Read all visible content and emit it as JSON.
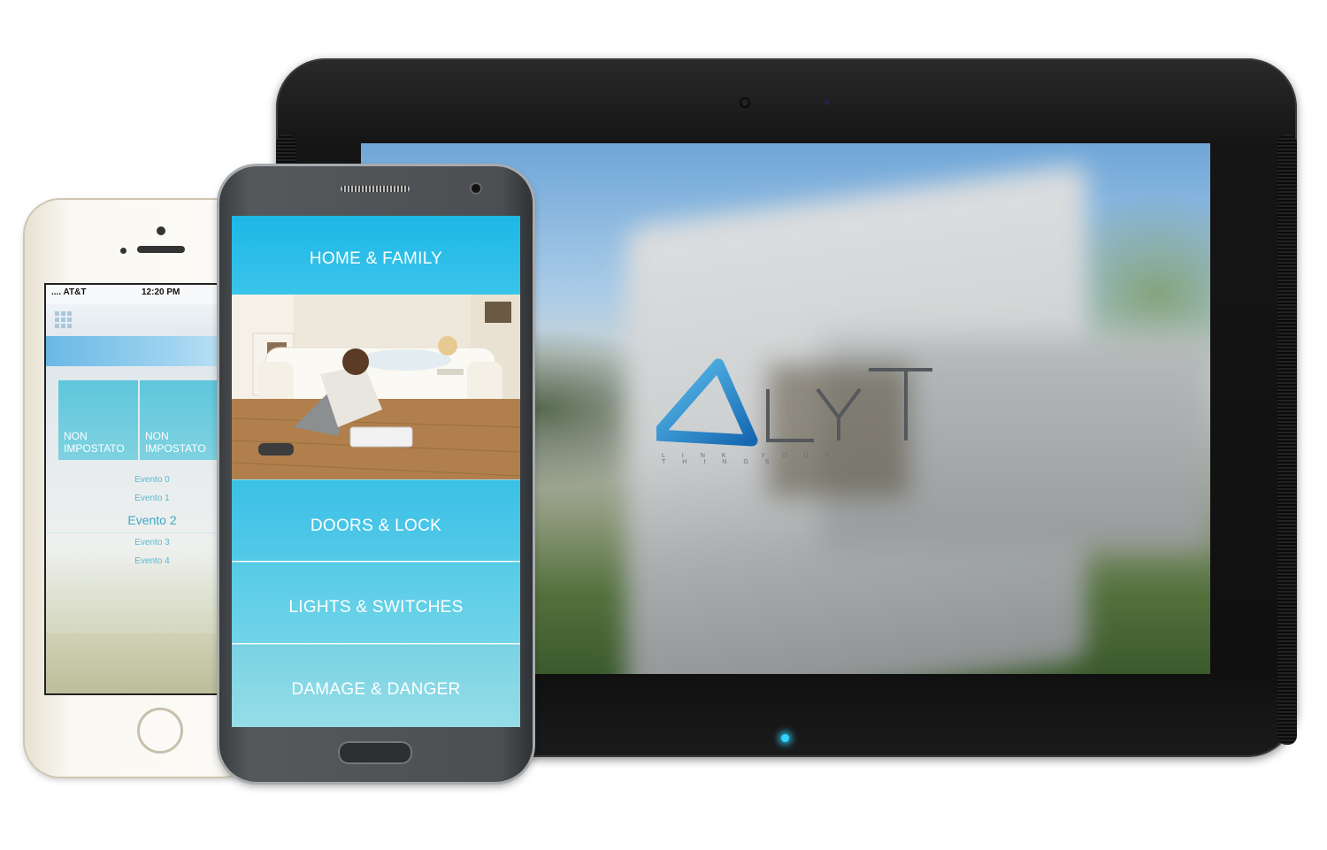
{
  "tablet": {
    "logo_text": "LYT",
    "tagline": "LINK YOUR THINGS",
    "colors": {
      "logo_blue": "#1f8fd0",
      "logo_grey": "#55585c",
      "led": "#2fd4ff"
    }
  },
  "iphone": {
    "status": {
      "carrier": ".... AT&T",
      "time": "12:20 PM"
    },
    "tiles": [
      {
        "label": "NON IMPOSTATO"
      },
      {
        "label": "NON IMPOSTATO"
      }
    ],
    "events": [
      "Evento 0",
      "Evento 1",
      "Evento 2",
      "Evento 3",
      "Evento 4"
    ],
    "selected_event": "Evento 2"
  },
  "android": {
    "menu": [
      {
        "label": "HOME & FAMILY"
      },
      {
        "label": "DOORS & LOCK"
      },
      {
        "label": "LIGHTS & SWITCHES"
      },
      {
        "label": "DAMAGE & DANGER"
      }
    ],
    "colors": {
      "primary": "#1db7e6",
      "light": "#95dde8"
    }
  }
}
